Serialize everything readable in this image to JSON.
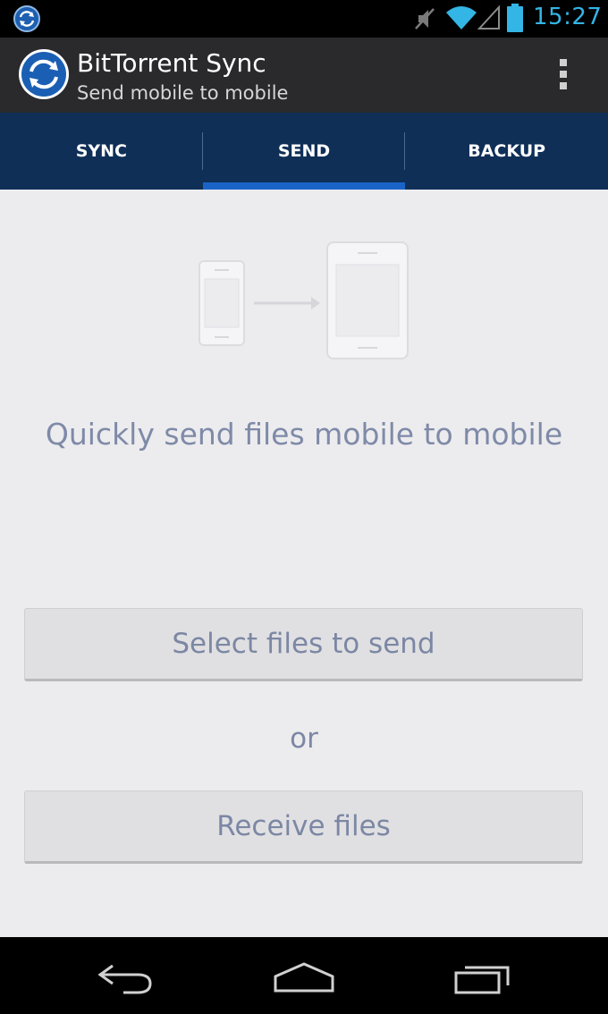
{
  "status_bar": {
    "time": "15:27",
    "icons": [
      "sync-notification-icon",
      "mute-icon",
      "wifi-icon",
      "signal-icon",
      "battery-icon"
    ],
    "accent_color": "#33b5e5"
  },
  "action_bar": {
    "title": "BitTorrent Sync",
    "subtitle": "Send mobile to mobile",
    "icon": "bittorrent-sync-logo",
    "menu_icon": "overflow-menu-icon"
  },
  "tabs": [
    {
      "label": "SYNC",
      "active": false
    },
    {
      "label": "SEND",
      "active": true
    },
    {
      "label": "BACKUP",
      "active": false
    }
  ],
  "main": {
    "illustration": "phone-to-tablet-icon",
    "tagline": "Quickly send files mobile to mobile",
    "select_button": "Select files to send",
    "or_text": "or",
    "receive_button": "Receive files"
  },
  "nav_bar": {
    "icons": [
      "back-icon",
      "home-icon",
      "recent-apps-icon"
    ]
  },
  "colors": {
    "tab_bar": "#0f2f57",
    "tab_indicator": "#1a64c8",
    "action_bar": "#2a2a2c",
    "content_bg": "#ececee",
    "text_muted": "#7c87a4"
  }
}
